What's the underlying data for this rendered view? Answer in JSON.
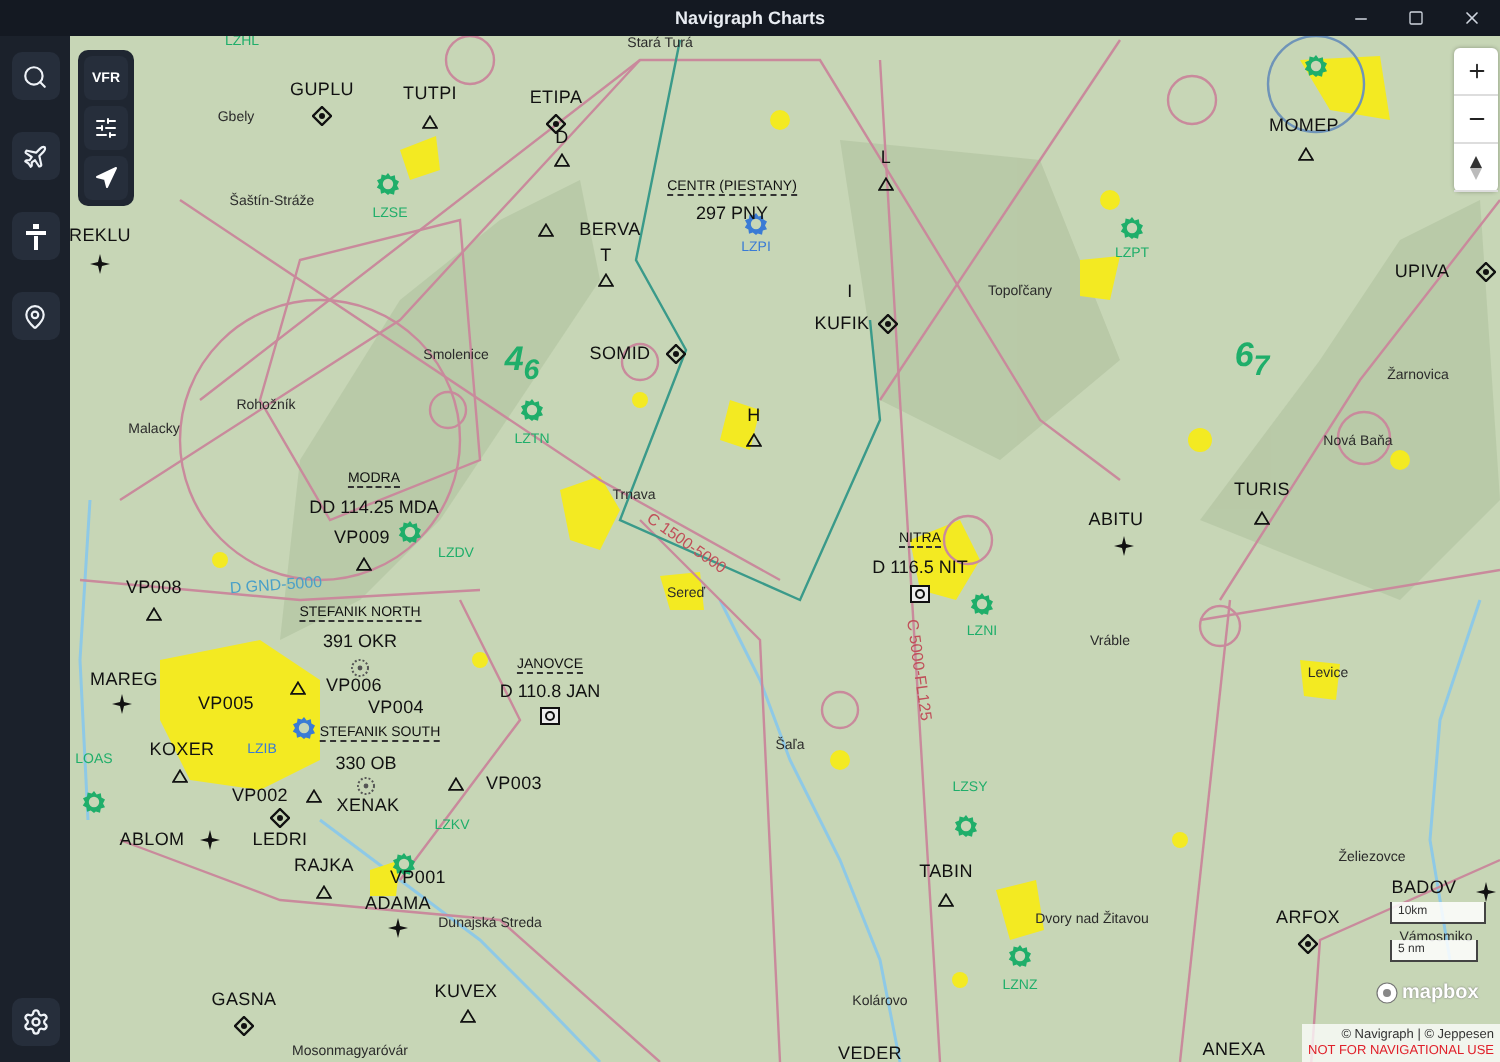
{
  "window": {
    "title": "Navigraph Charts"
  },
  "layer_panel": {
    "label": "VFR"
  },
  "map": {
    "waypoints": [
      {
        "name": "GUPLU",
        "kind": "vor"
      },
      {
        "name": "TUTPI",
        "kind": "triangle"
      },
      {
        "name": "ETIPA",
        "kind": "vor"
      },
      {
        "name": "D",
        "kind": "triangle"
      },
      {
        "name": "BERVA",
        "kind": "triangle"
      },
      {
        "name": "T",
        "kind": "triangle"
      },
      {
        "name": "REKLU",
        "kind": "cross"
      },
      {
        "name": "SOMID",
        "kind": "vor"
      },
      {
        "name": "KUFIK",
        "kind": "vor"
      },
      {
        "name": "L",
        "kind": "triangle"
      },
      {
        "name": "I",
        "kind": "none"
      },
      {
        "name": "H",
        "kind": "triangle"
      },
      {
        "name": "MOMEP",
        "kind": "triangle"
      },
      {
        "name": "UPIVA",
        "kind": "vor"
      },
      {
        "name": "TURIS",
        "kind": "triangle"
      },
      {
        "name": "ABITU",
        "kind": "cross"
      },
      {
        "name": "VP009",
        "kind": "triangle"
      },
      {
        "name": "VP008",
        "kind": "triangle"
      },
      {
        "name": "MAREG",
        "kind": "cross"
      },
      {
        "name": "VP006",
        "kind": "triangle"
      },
      {
        "name": "VP005",
        "kind": "none"
      },
      {
        "name": "VP004",
        "kind": "none"
      },
      {
        "name": "KOXER",
        "kind": "triangle"
      },
      {
        "name": "VP002",
        "kind": "vor"
      },
      {
        "name": "XENAK",
        "kind": "triangle"
      },
      {
        "name": "LEDRI",
        "kind": "none"
      },
      {
        "name": "ABLOM",
        "kind": "cross"
      },
      {
        "name": "RAJKA",
        "kind": "triangle"
      },
      {
        "name": "VP001",
        "kind": "none"
      },
      {
        "name": "ADAMA",
        "kind": "cross"
      },
      {
        "name": "VP003",
        "kind": "triangle"
      },
      {
        "name": "KUVEX",
        "kind": "triangle"
      },
      {
        "name": "GASNA",
        "kind": "vor"
      },
      {
        "name": "TABIN",
        "kind": "triangle"
      },
      {
        "name": "ARFOX",
        "kind": "vor"
      },
      {
        "name": "BADOV",
        "kind": "cross"
      },
      {
        "name": "ANEXA",
        "kind": "none"
      },
      {
        "name": "VEDER",
        "kind": "none"
      }
    ],
    "navaids": [
      {
        "name": "CENTR (PIESTANY)",
        "frequency": "297 PNY",
        "kind": "none"
      },
      {
        "name": "MODRA",
        "frequency": "DD 114.25 MDA",
        "kind": "none"
      },
      {
        "name": "STEFANIK NORTH",
        "frequency": "391 OKR",
        "kind": "ndb"
      },
      {
        "name": "JANOVCE",
        "frequency": "D 110.8 JAN",
        "kind": "dme"
      },
      {
        "name": "STEFANIK SOUTH",
        "frequency": "330 OB",
        "kind": "ndb"
      },
      {
        "name": "NITRA",
        "frequency": "D 116.5 NIT",
        "kind": "dme"
      }
    ],
    "towns": [
      "Stará Turá",
      "Gbely",
      "Šaštín-Stráže",
      "Smolenice",
      "Topoľčany",
      "Rohožník",
      "Malacky",
      "Trnava",
      "Sereď",
      "Žarnovica",
      "Nová Baňa",
      "Vráble",
      "Levice",
      "Šaľa",
      "Dunajská Streda",
      "Mosonmagyaróvár",
      "Kolárovo",
      "Dvory nad Žitavou",
      "Želiezovce",
      "Vámosmiko"
    ],
    "airports": [
      {
        "code": "LZSE",
        "color": "#1fae6a"
      },
      {
        "code": "LZPT",
        "color": "#1fae6a"
      },
      {
        "code": "LZTN",
        "color": "#1fae6a"
      },
      {
        "code": "LZDV",
        "color": "#1fae6a"
      },
      {
        "code": "LZNI",
        "color": "#1fae6a"
      },
      {
        "code": "LZSY",
        "color": "#1fae6a"
      },
      {
        "code": "LZNZ",
        "color": "#1fae6a"
      },
      {
        "code": "LZKV",
        "color": "#1fae6a"
      },
      {
        "code": "LOAS",
        "color": "#1fae6a"
      },
      {
        "code": "LZIB",
        "color": "#3a7bd5"
      },
      {
        "code": "LZPI",
        "color": "#3a7bd5"
      },
      {
        "code": "LZHL",
        "color": "#1fae6a"
      }
    ],
    "airspace_labels": [
      {
        "text": "C 1500-5000",
        "color": "#c0505a"
      },
      {
        "text": "D GND-5000",
        "color": "#4aa0c8"
      },
      {
        "text": "C 5000-FL125",
        "color": "#c0505a"
      }
    ],
    "sector_numbers": [
      "4$_{6}$",
      "6$_{7}$"
    ]
  },
  "scale": {
    "metric": "10km",
    "nautical": "5 nm"
  },
  "logo": "mapbox",
  "attribution": {
    "credits": "© Navigraph | © Jeppesen",
    "warning": "NOT FOR NAVIGATIONAL USE"
  }
}
